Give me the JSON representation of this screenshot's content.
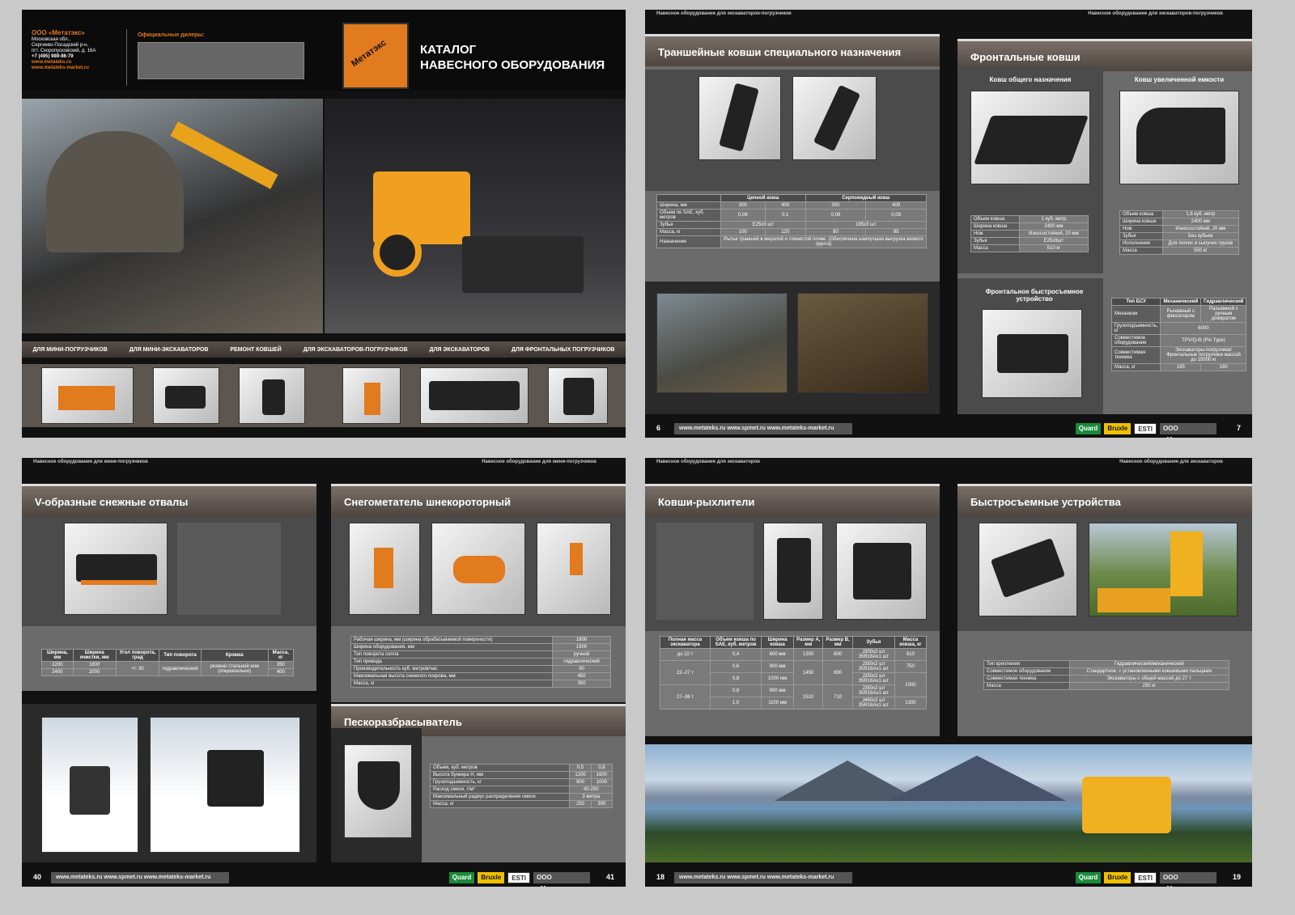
{
  "cover": {
    "company": "ООО «Метатэкс»",
    "address": [
      "Московская обл.,",
      "Сергиево-Посадский р-н,",
      "пгт. Скоропусковский, д. 16А"
    ],
    "phone": "+7 (495) 989-86-79",
    "site1": "www.metateks.ru",
    "site2": "www.metateks-market.ru",
    "dealers_label": "Официальные дилеры:",
    "logo_text": "Метатэкс",
    "title_line1": "КАТАЛОГ",
    "title_line2": "НАВЕСНОГО ОБОРУДОВАНИЯ",
    "nav": [
      "ДЛЯ МИНИ-ПОГРУЗЧИКОВ",
      "ДЛЯ МИНИ-ЭКСКАВАТОРОВ",
      "РЕМОНТ КОВШЕЙ",
      "ДЛЯ ЭКСКАВАТОРОВ-ПОГРУЗЧИКОВ",
      "ДЛЯ ЭКСКАВАТОРОВ",
      "ДЛЯ ФРОНТАЛЬНЫХ ПОГРУЗЧИКОВ"
    ]
  },
  "footer": {
    "links": "www.metateks.ru   www.spmet.ru   www.metateks-market.ru",
    "logo_quard": "Quard",
    "logo_bruxle": "Bruxle",
    "logo_esti": "ESTI",
    "company": "ООО «Метатэкс»"
  },
  "s2": {
    "strip_left": "Навесное оборудование для экскаваторов-погрузчиков",
    "strip_right": "Навесное оборудование для экскаваторов-погрузчиков",
    "page_left": "6",
    "page_right": "7",
    "title_left": "Траншейные ковши специального назначения",
    "title_right": "Фронтальные ковши",
    "trench": {
      "h1": "Цепной ковш",
      "h2": "Серповидный ковш",
      "rows": [
        [
          "Ширина, мм",
          "300",
          "400",
          "300",
          "400"
        ],
        [
          "Объем по SAE, куб. метров",
          "0,08",
          "0,1",
          "0,06",
          "0,08"
        ],
        [
          "Зубья",
          "E25x3 шт",
          "",
          "185x3 шт",
          ""
        ],
        [
          "Масса, кг",
          "100",
          "120",
          "80",
          "95"
        ]
      ],
      "purpose_label": "Назначение",
      "purpose": "Рытье траншей в мерзлой и глинистой почве. (Обеспечена наилучшая выгрузка вязкого грунта)"
    },
    "general_title": "Ковш общего назначения",
    "large_title": "Ковш увеличенной емкости",
    "general": [
      [
        "Объем ковша",
        "1 куб. метр"
      ],
      [
        "Ширина ковша",
        "2400 мм"
      ],
      [
        "Нож",
        "Износостойкий, 20 мм"
      ],
      [
        "Зубья",
        "E25x9шт"
      ],
      [
        "Масса",
        "510 кг"
      ]
    ],
    "large": [
      [
        "Объем ковша",
        "1,8 куб. метр"
      ],
      [
        "Ширина ковша",
        "2400 мм"
      ],
      [
        "Нож",
        "Износостойкий, 20 мм"
      ],
      [
        "Зубья",
        "Без зубьев"
      ],
      [
        "Исполнение",
        "Для легких и сыпучих грузов"
      ],
      [
        "Масса",
        "550 кг"
      ]
    ],
    "quick_title": "Фронтальное быстросъемное устройство",
    "quick_head": [
      "Тип БСУ",
      "Механический",
      "Гидравлический"
    ],
    "quick_rows": [
      [
        "Механизм",
        "Рычажный с фиксатором",
        "Разъемной с ручным домкратом"
      ],
      [
        "Грузоподъемность, кг",
        "6000",
        ""
      ],
      [
        "Совместимое оборудование",
        "TPV/Q-fit (Pin Type)",
        ""
      ],
      [
        "Совместимая техника",
        "Экскаваторы-погрузчики/ Фронтальные погрузчики массой до 15000 кг",
        ""
      ],
      [
        "Масса, кг",
        "165",
        "160"
      ]
    ]
  },
  "s3": {
    "strip_left": "Навесное оборудование для мини-погрузчиков",
    "strip_right": "Навесное оборудование для мини-погрузчиков",
    "page_left": "40",
    "page_right": "41",
    "title_a": "V-образные снежные отвалы",
    "title_b": "Снегометатель шнекороторный",
    "title_c": "Пескоразбрасыватель",
    "v_head": [
      "Ширина, мм",
      "Ширина очистки, мм",
      "Угол поворота, град",
      "Тип поворота",
      "Кромка",
      "Масса, кг"
    ],
    "v_rows": [
      [
        "2200",
        "1800",
        "+/- 30",
        "гидравлический",
        "резина/ стальной нож (опционально)",
        "350"
      ],
      [
        "2400",
        "2000",
        "",
        "",
        "",
        "400"
      ]
    ],
    "snow_rows": [
      [
        "Рабочая ширина, мм (ширина обрабатываемой поверхности)",
        "1800"
      ],
      [
        "Ширина оборудования, мм",
        "1900"
      ],
      [
        "Тип поворота сопла",
        "ручной"
      ],
      [
        "Тип привода",
        "гидравлический"
      ],
      [
        "Производительность куб. метров/час",
        "90"
      ],
      [
        "Максимальная высота снежного покрова, мм",
        "450"
      ],
      [
        "Масса, кг",
        "300"
      ]
    ],
    "sand_rows": [
      [
        "Объем, куб. метров",
        "0,5",
        "0,8"
      ],
      [
        "Высота бункера Н, мм",
        "1200",
        "1600"
      ],
      [
        "Грузоподъемность, кг",
        "800",
        "1000"
      ],
      [
        "Расход смеси, г/м²",
        "40-250",
        ""
      ],
      [
        "Максимальный радиус распределения смеси",
        "3 метра",
        ""
      ],
      [
        "Масса, кг",
        "250",
        "300"
      ]
    ]
  },
  "s4": {
    "strip_left": "Навесное оборудование для экскаваторов",
    "strip_right": "Навесное оборудование для экскаваторов",
    "page_left": "18",
    "page_right": "19",
    "title_left": "Ковши-рыхлители",
    "title_right": "Быстросъемные устройства",
    "rip_head": [
      "Полная масса экскаватора",
      "Объем ковша по SAE, куб. метров",
      "Ширина ковша",
      "Размер А, мм",
      "Размер В, мм",
      "Зубья",
      "Масса ковша, кг"
    ],
    "rip_rows": [
      [
        "до 22 т",
        "0,4",
        "600 мм",
        "1300",
        "600",
        "J300x2 шт 35R16Ax1 шт",
        "610"
      ],
      [
        "22–27 т",
        "0,6",
        "900 мм",
        "1450",
        "690",
        "J350x2 шт 35R16Ax1 шт",
        "750"
      ],
      [
        "",
        "0,8",
        "1000 мм",
        "",
        "",
        "J350x2 шт 35R16Ax1 шт",
        "1000"
      ],
      [
        "27–36 т",
        "0,8",
        "900 мм",
        "1510",
        "710",
        "J350x2 шт 35R16Ax1 шт",
        ""
      ],
      [
        "",
        "1,0",
        "1100 мм",
        "",
        "",
        "J460x2 шт 35R16Ax1 шт",
        "1300"
      ]
    ],
    "qc_rows": [
      [
        "Тип крепления",
        "Гидравлический/механический"
      ],
      [
        "Совместимое оборудование",
        "Стандартное, с установленными ковшевыми пальцами"
      ],
      [
        "Совместимая техника",
        "Экскаваторы с общей массой до 27 т"
      ],
      [
        "Масса",
        "250 кг"
      ]
    ]
  },
  "colors": {
    "accent": "#e27a1e",
    "dark": "#111111",
    "panel": "#6b6b6b",
    "header": "#4e4540"
  }
}
